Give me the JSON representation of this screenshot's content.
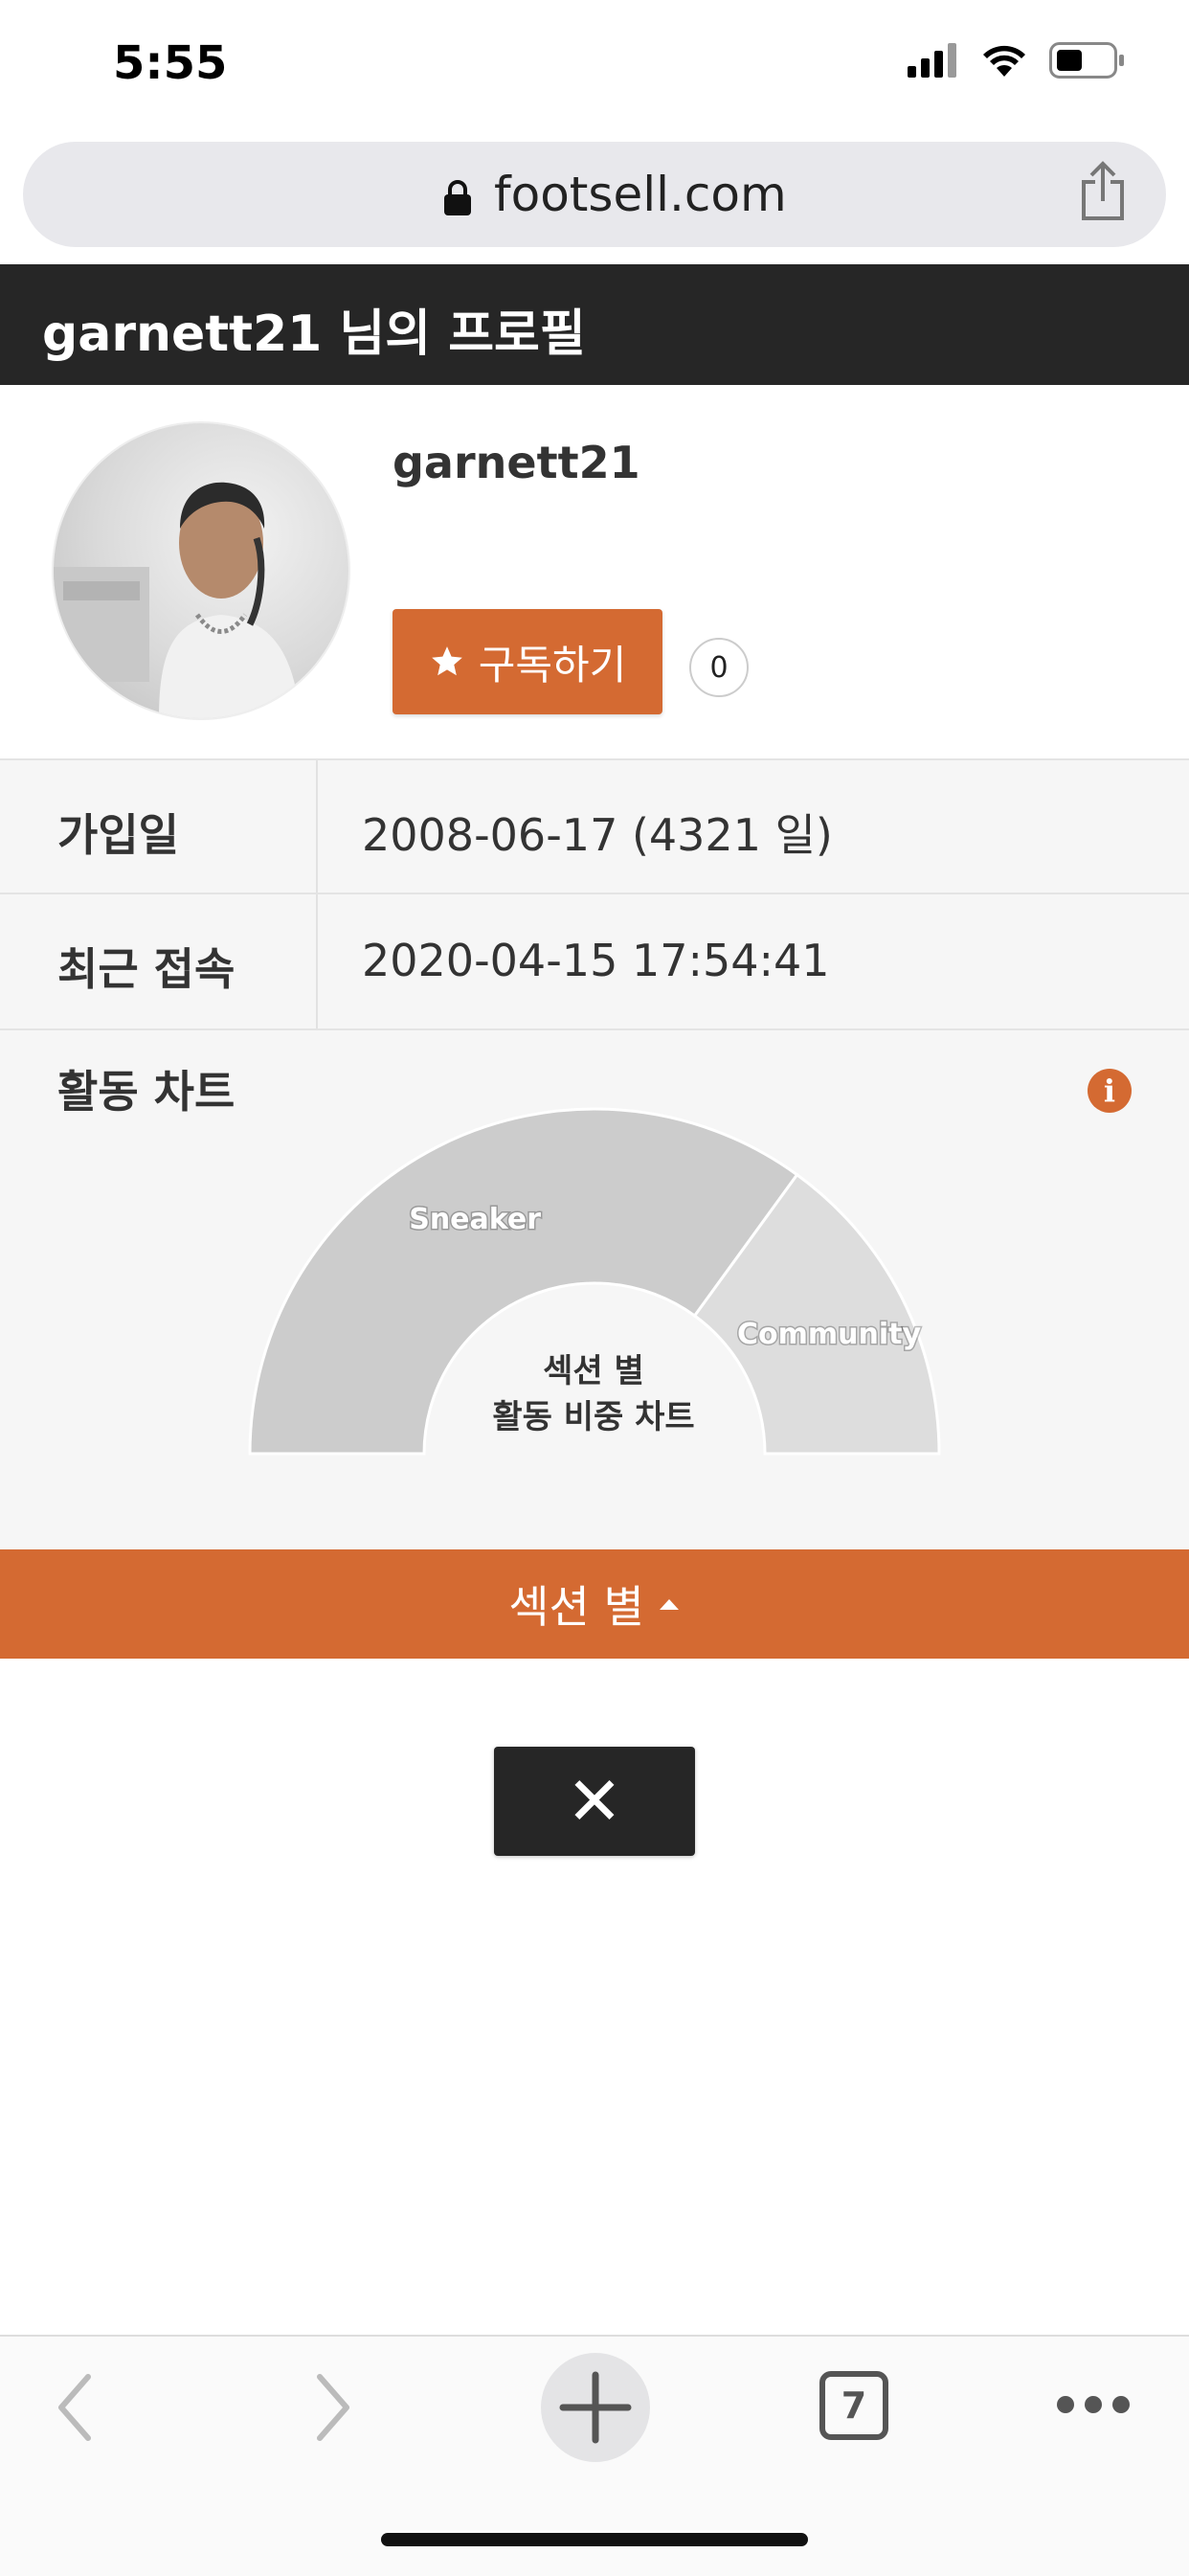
{
  "status_bar": {
    "time": "5:55",
    "icons": [
      "cellular-signal-icon",
      "wifi-icon",
      "battery-icon"
    ]
  },
  "browser": {
    "url": "footsell.com",
    "lock_icon": "lock-icon",
    "share_icon": "share-icon"
  },
  "profile_page": {
    "title": "garnett21 님의 프로필",
    "username": "garnett21",
    "subscribe_label": "구독하기",
    "subscriber_count": "0"
  },
  "info_rows": [
    {
      "label": "가입일",
      "value": "2008-06-17 (4321 일)"
    },
    {
      "label": "최근 접속",
      "value": "2020-04-15 17:54:41"
    }
  ],
  "activity": {
    "title": "활동 차트",
    "center_line1": "섹션 별",
    "center_line2": "활동 비중 차트"
  },
  "chart_data": {
    "type": "pie",
    "categories": [
      "Sneaker",
      "Community"
    ],
    "values": [
      70,
      30
    ],
    "colors": [
      "#cccccc",
      "#dddddd"
    ]
  },
  "section_toggle": {
    "label": "섹션 별",
    "icon": "caret-up-icon"
  },
  "close_button": {
    "label": "✕"
  },
  "toolbar": {
    "tabs_count": "7",
    "items": [
      "back-icon",
      "forward-icon",
      "new-tab-icon",
      "tabs-icon",
      "more-icon"
    ]
  },
  "colors": {
    "accent": "#d46a32",
    "header_bg": "#262626"
  }
}
